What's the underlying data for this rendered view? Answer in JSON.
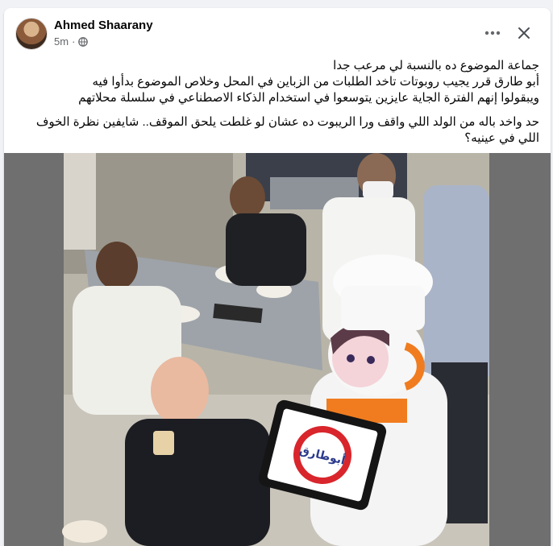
{
  "post": {
    "author": "Ahmed Shaarany",
    "time": "5m",
    "separator": "·",
    "privacy_icon": "globe-icon",
    "more_icon": "more-dots-icon",
    "close_icon": "close-icon",
    "text_lines": [
      "جماعة الموضوع ده بالنسبة لي مرعب جدا",
      "أبو طارق قرر يجيب روبوتات تاخد الطلبات من الزباين في المحل وخلاص الموضوع بدأوا فيه",
      "ويبقولوا إنهم الفترة الجاية عايزين يتوسعوا في استخدام الذكاء الاصطناعي في سلسلة محلاتهم"
    ],
    "text_para2": "حد واخد باله من الولد اللي واقف ورا الريبوت ده عشان لو غلطت يلحق الموقف.. شايفين نظرة الخوف اللي في عينيه؟",
    "image": {
      "tablet_logo_text": "أبوطارق",
      "colors": {
        "robot_accent": "#f07c1f",
        "logo_red": "#d8262c",
        "logo_blue": "#2b3a8c"
      }
    }
  }
}
